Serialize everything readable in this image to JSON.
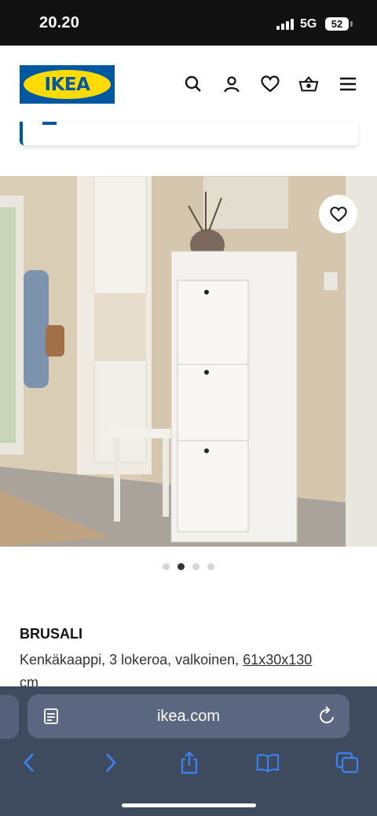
{
  "status_bar": {
    "time": "20.20",
    "network": "5G",
    "battery": "52"
  },
  "header": {
    "logo_text": "IKEA",
    "icons": [
      "search-icon",
      "account-icon",
      "heart-icon",
      "cart-icon",
      "menu-icon"
    ],
    "brand_blue": "#0058a3",
    "brand_yellow": "#ffdb00"
  },
  "carousel": {
    "count": 4,
    "active_index": 1
  },
  "product": {
    "name": "BRUSALI",
    "description": "Kenkäkaappi, 3 lokeroa, valkoinen, ",
    "size": "61x30x130",
    "unit": "cm"
  },
  "browser": {
    "url": "ikea.com",
    "toolbar_icons": [
      "back-icon",
      "forward-icon",
      "share-icon",
      "bookmarks-icon",
      "tabs-icon"
    ]
  }
}
